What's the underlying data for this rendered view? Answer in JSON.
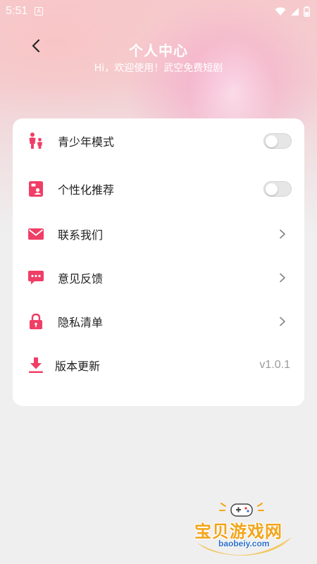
{
  "status_bar": {
    "time": "5:51",
    "app_icon": "A"
  },
  "header": {
    "back_icon": "chevron-left-icon",
    "title": "个人中心",
    "subtitle": "Hi，欢迎使用！武空免费短剧"
  },
  "menu": {
    "items": [
      {
        "label": "青少年模式",
        "icon": "family-icon",
        "control": "toggle",
        "on": false
      },
      {
        "label": "个性化推荐",
        "icon": "profile-card-icon",
        "control": "toggle",
        "on": false
      },
      {
        "label": "联系我们",
        "icon": "mail-icon",
        "control": "chevron"
      },
      {
        "label": "意见反馈",
        "icon": "chat-bubble-icon",
        "control": "chevron"
      },
      {
        "label": "隐私清单",
        "icon": "lock-icon",
        "control": "chevron"
      },
      {
        "label": "版本更新",
        "icon": "download-icon",
        "control": "value",
        "value": "v1.0.1"
      }
    ]
  },
  "watermark": {
    "text": "宝贝游戏网",
    "url": "baobeiy.com"
  },
  "colors": {
    "accent": "#f03e66",
    "card": "#ffffff",
    "background": "#efefef"
  }
}
